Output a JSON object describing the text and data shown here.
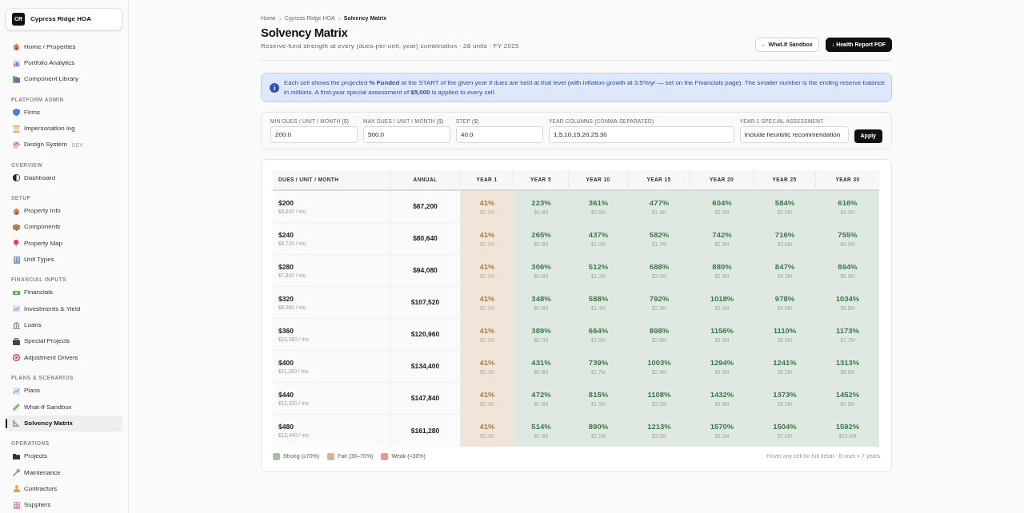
{
  "sidebar": {
    "brand": {
      "logo": "CR",
      "name": "Cypress Ridge HOA"
    },
    "sections": [
      {
        "items": [
          {
            "label": "Home / Properties",
            "selected": false
          },
          {
            "label": "Portfolio Analytics",
            "selected": false
          },
          {
            "label": "Component Library",
            "selected": false
          }
        ]
      },
      {
        "title": "PLATFORM ADMIN",
        "items": [
          {
            "label": "Firms",
            "selected": false
          },
          {
            "label": "Impersonation log",
            "selected": false
          },
          {
            "label": "Design System",
            "badge": "DEV",
            "selected": false
          }
        ]
      },
      {
        "title": "OVERVIEW",
        "items": [
          {
            "label": "Dashboard",
            "selected": false
          }
        ]
      },
      {
        "title": "SETUP",
        "items": [
          {
            "label": "Property Info",
            "selected": false
          },
          {
            "label": "Components",
            "selected": false
          },
          {
            "label": "Property Map",
            "selected": false
          },
          {
            "label": "Unit Types",
            "selected": false
          }
        ]
      },
      {
        "title": "FINANCIAL INPUTS",
        "items": [
          {
            "label": "Financials",
            "selected": false
          },
          {
            "label": "Investments & Yield",
            "selected": false
          },
          {
            "label": "Loans",
            "selected": false
          },
          {
            "label": "Special Projects",
            "selected": false
          },
          {
            "label": "Adjustment Drivers",
            "selected": false
          }
        ]
      },
      {
        "title": "PLANS & SCENARIOS",
        "items": [
          {
            "label": "Plans",
            "selected": false
          },
          {
            "label": "What-If Sandbox",
            "selected": false
          },
          {
            "label": "Solvency Matrix",
            "selected": true
          }
        ]
      },
      {
        "title": "OPERATIONS",
        "items": [
          {
            "label": "Projects",
            "selected": false
          },
          {
            "label": "Maintenance",
            "selected": false
          },
          {
            "label": "Contractors",
            "selected": false
          },
          {
            "label": "Suppliers",
            "selected": false
          }
        ]
      }
    ]
  },
  "header": {
    "breadcrumb": [
      "Home",
      "Cypress Ridge HOA",
      "Solvency Matrix"
    ],
    "title": "Solvency Matrix",
    "subtitle": "Reserve-fund strength at every (dues-per-unit, year) combination · 28 units · FY 2025",
    "actions": [
      {
        "label": "← What-If Sandbox",
        "kind": "secondary"
      },
      {
        "label": "↓ Health Report PDF",
        "kind": "primary"
      }
    ]
  },
  "notice": {
    "text": "Each cell shows the projected **% Funded** at the START of the given year if dues are held at that level (with inflation growth at 3.5%/yr — set on the Financials page). The smaller number is the ending reserve balance in millions. A first-year special assessment of **$5,000** is applied to every cell."
  },
  "controls": {
    "fields": [
      {
        "label": "MIN DUES / UNIT / MONTH ($)",
        "value": "200.0"
      },
      {
        "label": "MAX DUES / UNIT / MONTH ($)",
        "value": "500.0"
      },
      {
        "label": "STEP ($)",
        "value": "40.0"
      },
      {
        "label": "YEAR COLUMNS (COMMA-SEPARATED)",
        "value": "1,5,10,15,20,25,30"
      },
      {
        "label": "YEAR-1 SPECIAL ASSESSMENT",
        "value": "Include heuristic recommendation"
      }
    ],
    "apply_button": "Apply"
  },
  "matrix": {
    "dues_column": "DUES / UNIT / MONTH",
    "annual_column": "ANNUAL",
    "year_columns": [
      "YEAR 1",
      "YEAR 5",
      "YEAR 10",
      "YEAR 15",
      "YEAR 20",
      "YEAR 25",
      "YEAR 30"
    ],
    "rows": [
      {
        "dues": "$200",
        "monthly_total": "$5,600 / mo",
        "annual": "$67,200",
        "cells": [
          {
            "percent": "41%",
            "balance": "$0.1M",
            "kind": "fair"
          },
          {
            "percent": "223%",
            "balance": "$0.4M",
            "kind": "strong"
          },
          {
            "percent": "361%",
            "balance": "$0.8M",
            "kind": "strong"
          },
          {
            "percent": "477%",
            "balance": "$1.4M",
            "kind": "strong"
          },
          {
            "percent": "604%",
            "balance": "$2.0M",
            "kind": "strong"
          },
          {
            "percent": "584%",
            "balance": "$2.9M",
            "kind": "strong"
          },
          {
            "percent": "616%",
            "balance": "$4.0M",
            "kind": "strong"
          }
        ]
      },
      {
        "dues": "$240",
        "monthly_total": "$6,720 / mo",
        "annual": "$80,640",
        "cells": [
          {
            "percent": "41%",
            "balance": "$0.1M",
            "kind": "fair"
          },
          {
            "percent": "265%",
            "balance": "$0.5M",
            "kind": "strong"
          },
          {
            "percent": "437%",
            "balance": "$1.0M",
            "kind": "strong"
          },
          {
            "percent": "582%",
            "balance": "$1.7M",
            "kind": "strong"
          },
          {
            "percent": "742%",
            "balance": "$2.5M",
            "kind": "strong"
          },
          {
            "percent": "716%",
            "balance": "$3.6M",
            "kind": "strong"
          },
          {
            "percent": "755%",
            "balance": "$4.9M",
            "kind": "strong"
          }
        ]
      },
      {
        "dues": "$280",
        "monthly_total": "$7,840 / mo",
        "annual": "$94,080",
        "cells": [
          {
            "percent": "41%",
            "balance": "$0.1M",
            "kind": "fair"
          },
          {
            "percent": "306%",
            "balance": "$0.6M",
            "kind": "strong"
          },
          {
            "percent": "512%",
            "balance": "$1.2M",
            "kind": "strong"
          },
          {
            "percent": "688%",
            "balance": "$2.0M",
            "kind": "strong"
          },
          {
            "percent": "880%",
            "balance": "$2.9M",
            "kind": "strong"
          },
          {
            "percent": "847%",
            "balance": "$4.3M",
            "kind": "strong"
          },
          {
            "percent": "894%",
            "balance": "$5.9M",
            "kind": "strong"
          }
        ]
      },
      {
        "dues": "$320",
        "monthly_total": "$8,960 / mo",
        "annual": "$107,520",
        "cells": [
          {
            "percent": "41%",
            "balance": "$0.1M",
            "kind": "fair"
          },
          {
            "percent": "348%",
            "balance": "$0.6M",
            "kind": "strong"
          },
          {
            "percent": "588%",
            "balance": "$1.4M",
            "kind": "strong"
          },
          {
            "percent": "792%",
            "balance": "$2.3M",
            "kind": "strong"
          },
          {
            "percent": "1018%",
            "balance": "$3.4M",
            "kind": "strong"
          },
          {
            "percent": "978%",
            "balance": "$4.9M",
            "kind": "strong"
          },
          {
            "percent": "1034%",
            "balance": "$6.8M",
            "kind": "strong"
          }
        ]
      },
      {
        "dues": "$360",
        "monthly_total": "$10,080 / mo",
        "annual": "$120,960",
        "cells": [
          {
            "percent": "41%",
            "balance": "$0.1M",
            "kind": "fair"
          },
          {
            "percent": "389%",
            "balance": "$0.7M",
            "kind": "strong"
          },
          {
            "percent": "664%",
            "balance": "$1.5M",
            "kind": "strong"
          },
          {
            "percent": "898%",
            "balance": "$2.6M",
            "kind": "strong"
          },
          {
            "percent": "1156%",
            "balance": "$3.9M",
            "kind": "strong"
          },
          {
            "percent": "1110%",
            "balance": "$5.6M",
            "kind": "strong"
          },
          {
            "percent": "1173%",
            "balance": "$7.7M",
            "kind": "strong"
          }
        ]
      },
      {
        "dues": "$400",
        "monthly_total": "$11,200 / mo",
        "annual": "$134,400",
        "cells": [
          {
            "percent": "41%",
            "balance": "$0.2M",
            "kind": "fair"
          },
          {
            "percent": "431%",
            "balance": "$0.8M",
            "kind": "strong"
          },
          {
            "percent": "739%",
            "balance": "$1.7M",
            "kind": "strong"
          },
          {
            "percent": "1003%",
            "balance": "$2.9M",
            "kind": "strong"
          },
          {
            "percent": "1294%",
            "balance": "$4.3M",
            "kind": "strong"
          },
          {
            "percent": "1241%",
            "balance": "$6.2M",
            "kind": "strong"
          },
          {
            "percent": "1313%",
            "balance": "$8.6M",
            "kind": "strong"
          }
        ]
      },
      {
        "dues": "$440",
        "monthly_total": "$12,320 / mo",
        "annual": "$147,840",
        "cells": [
          {
            "percent": "41%",
            "balance": "$0.2M",
            "kind": "fair"
          },
          {
            "percent": "472%",
            "balance": "$0.9M",
            "kind": "strong"
          },
          {
            "percent": "815%",
            "balance": "$1.9M",
            "kind": "strong"
          },
          {
            "percent": "1108%",
            "balance": "$3.2M",
            "kind": "strong"
          },
          {
            "percent": "1432%",
            "balance": "$4.8M",
            "kind": "strong"
          },
          {
            "percent": "1373%",
            "balance": "$6.9M",
            "kind": "strong"
          },
          {
            "percent": "1452%",
            "balance": "$9.5M",
            "kind": "strong"
          }
        ]
      },
      {
        "dues": "$480",
        "monthly_total": "$13,440 / mo",
        "annual": "$161,280",
        "cells": [
          {
            "percent": "41%",
            "balance": "$0.2M",
            "kind": "fair"
          },
          {
            "percent": "514%",
            "balance": "$0.9M",
            "kind": "strong"
          },
          {
            "percent": "890%",
            "balance": "$2.1M",
            "kind": "strong"
          },
          {
            "percent": "1213%",
            "balance": "$3.5M",
            "kind": "strong"
          },
          {
            "percent": "1570%",
            "balance": "$5.2M",
            "kind": "strong"
          },
          {
            "percent": "1504%",
            "balance": "$7.6M",
            "kind": "strong"
          },
          {
            "percent": "1592%",
            "balance": "$10.4M",
            "kind": "strong"
          }
        ]
      }
    ],
    "legend": [
      {
        "label": "Strong (≥70%)",
        "color": "#9fc2a6"
      },
      {
        "label": "Fair (30–70%)",
        "color": "#d8b48c"
      },
      {
        "label": "Weak (<30%)",
        "color": "#e19c95"
      }
    ],
    "footnote": "Hover any cell for full detail · 8 rows × 7 years"
  }
}
